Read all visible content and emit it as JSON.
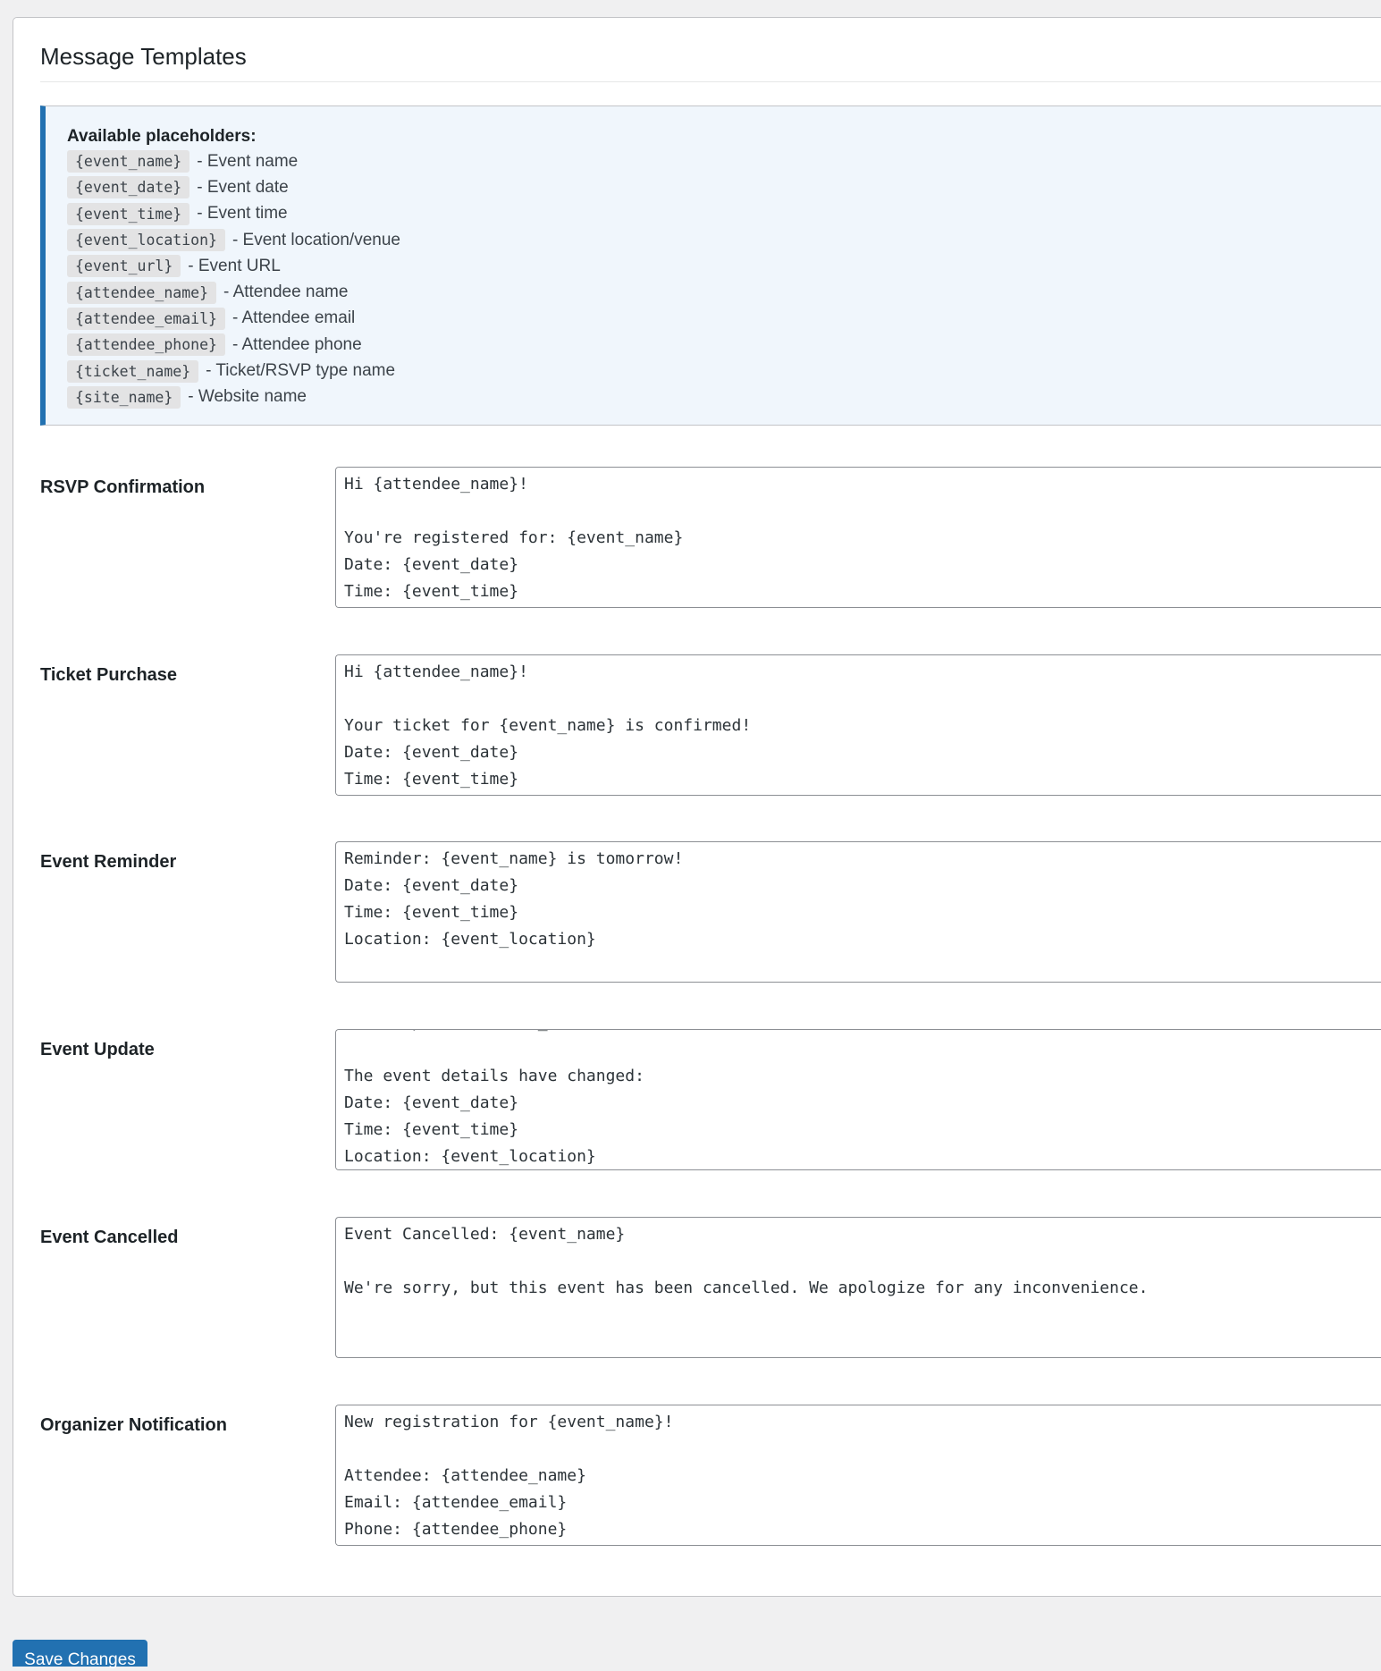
{
  "header": {
    "title": "Message Templates"
  },
  "placeholders": {
    "heading": "Available placeholders:",
    "items": [
      {
        "code": "{event_name}",
        "desc": "- Event name"
      },
      {
        "code": "{event_date}",
        "desc": "- Event date"
      },
      {
        "code": "{event_time}",
        "desc": "- Event time"
      },
      {
        "code": "{event_location}",
        "desc": "- Event location/venue"
      },
      {
        "code": "{event_url}",
        "desc": "- Event URL"
      },
      {
        "code": "{attendee_name}",
        "desc": "- Attendee name"
      },
      {
        "code": "{attendee_email}",
        "desc": "- Attendee email"
      },
      {
        "code": "{attendee_phone}",
        "desc": "- Attendee phone"
      },
      {
        "code": "{ticket_name}",
        "desc": "- Ticket/RSVP type name"
      },
      {
        "code": "{site_name}",
        "desc": "- Website name"
      }
    ]
  },
  "templates": [
    {
      "label": "RSVP Confirmation",
      "value": "Hi {attendee_name}!\n\nYou're registered for: {event_name}\nDate: {event_date}\nTime: {event_time}"
    },
    {
      "label": "Ticket Purchase",
      "value": "Hi {attendee_name}!\n\nYour ticket for {event_name} is confirmed!\nDate: {event_date}\nTime: {event_time}"
    },
    {
      "label": "Event Reminder",
      "value": "Reminder: {event_name} is tomorrow!\nDate: {event_date}\nTime: {event_time}\nLocation: {event_location}"
    },
    {
      "label": "Event Update",
      "value": "Event Update: {event_name}\n\nThe event details have changed:\nDate: {event_date}\nTime: {event_time}\nLocation: {event_location}"
    },
    {
      "label": "Event Cancelled",
      "value": "Event Cancelled: {event_name}\n\nWe're sorry, but this event has been cancelled. We apologize for any inconvenience."
    },
    {
      "label": "Organizer Notification",
      "value": "New registration for {event_name}!\n\nAttendee: {attendee_name}\nEmail: {attendee_email}\nPhone: {attendee_phone}"
    }
  ],
  "footer": {
    "save_label": "Save Changes"
  },
  "colors": {
    "accent": "#2271b1",
    "notice_bg": "#f0f6fc",
    "page_bg": "#f0f0f1"
  }
}
